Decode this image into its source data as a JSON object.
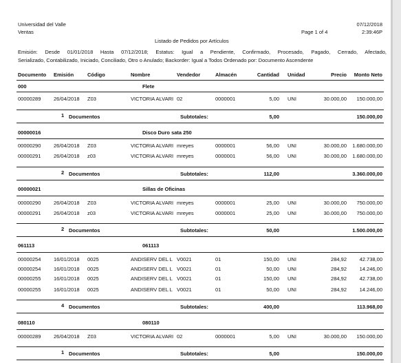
{
  "header": {
    "company": "Universidad del Valle",
    "module": "Ventas",
    "date": "07/12/2018",
    "page": "Page 1 of 4",
    "time": "2:39:46P",
    "title": "Listado de Pedidos por Artículos"
  },
  "params": {
    "line1": "Emisión: Desde 01/01/2018 Hasta 07/12/2018; Estatus: Igual a Pendiente, Confirmado, Procesado, Pagado, Cerrado, Afectado,",
    "line2": "Serializado, Contabilizado, Iniciado, Conciliado, Otro o Anulado; Backorder: Igual a Todos Ordenado por: Documento Ascendente"
  },
  "columns": {
    "documento": "Documento",
    "emision": "Emisión",
    "codigo": "Código",
    "nombre": "Nombre",
    "vendedor": "Vendedor",
    "almacen": "Almacén",
    "cantidad": "Cantidad",
    "unidad": "Unidad",
    "precio": "Precio",
    "monto": "Monto Neto"
  },
  "labels": {
    "documentos": "Documentos",
    "subtotales": "Subtotales:"
  },
  "groups": [
    {
      "code": "000",
      "name": "Flete",
      "rows": [
        {
          "doc": "00000289",
          "date": "26/04/2018",
          "cod": "Z03",
          "nombre": "VICTORIA ALVARI",
          "vend": "02",
          "alm": "0000001",
          "cant": "5,00",
          "uni": "UNI",
          "precio": "30.000,00",
          "monto": "150.000,00"
        }
      ],
      "count": "1",
      "sub_cant": "5,00",
      "sub_monto": "150.000,00"
    },
    {
      "code": "00000016",
      "name": "Disco Duro sata 250",
      "rows": [
        {
          "doc": "00000290",
          "date": "26/04/2018",
          "cod": "Z03",
          "nombre": "VICTORIA ALVARI",
          "vend": "mreyes",
          "alm": "0000001",
          "cant": "56,00",
          "uni": "UNI",
          "precio": "30.000,00",
          "monto": "1.680.000,00"
        },
        {
          "doc": "00000291",
          "date": "26/04/2018",
          "cod": "z03",
          "nombre": "VICTORIA ALVARI",
          "vend": "mreyes",
          "alm": "0000001",
          "cant": "56,00",
          "uni": "UNI",
          "precio": "30.000,00",
          "monto": "1.680.000,00"
        }
      ],
      "count": "2",
      "sub_cant": "112,00",
      "sub_monto": "3.360.000,00"
    },
    {
      "code": "00000021",
      "name": "Sillas de Oficinas",
      "rows": [
        {
          "doc": "00000290",
          "date": "26/04/2018",
          "cod": "Z03",
          "nombre": "VICTORIA ALVARI",
          "vend": "mreyes",
          "alm": "0000001",
          "cant": "25,00",
          "uni": "UNI",
          "precio": "30.000,00",
          "monto": "750.000,00"
        },
        {
          "doc": "00000291",
          "date": "26/04/2018",
          "cod": "z03",
          "nombre": "VICTORIA ALVARI",
          "vend": "mreyes",
          "alm": "0000001",
          "cant": "25,00",
          "uni": "UNI",
          "precio": "30.000,00",
          "monto": "750.000,00"
        }
      ],
      "count": "2",
      "sub_cant": "50,00",
      "sub_monto": "1.500.000,00"
    },
    {
      "code": "061113",
      "name": "061113",
      "rows": [
        {
          "doc": "00000254",
          "date": "16/01/2018",
          "cod": "0025",
          "nombre": "ANDISERV DEL L",
          "vend": "V0021",
          "alm": "01",
          "cant": "150,00",
          "uni": "UNI",
          "precio": "284,92",
          "monto": "42.738,00"
        },
        {
          "doc": "00000254",
          "date": "16/01/2018",
          "cod": "0025",
          "nombre": "ANDISERV DEL L",
          "vend": "V0021",
          "alm": "01",
          "cant": "50,00",
          "uni": "UNI",
          "precio": "284,92",
          "monto": "14.246,00"
        },
        {
          "doc": "00000255",
          "date": "16/01/2018",
          "cod": "0025",
          "nombre": "ANDISERV DEL L",
          "vend": "V0021",
          "alm": "01",
          "cant": "150,00",
          "uni": "UNI",
          "precio": "284,92",
          "monto": "42.738,00"
        },
        {
          "doc": "00000255",
          "date": "16/01/2018",
          "cod": "0025",
          "nombre": "ANDISERV DEL L",
          "vend": "V0021",
          "alm": "01",
          "cant": "50,00",
          "uni": "UNI",
          "precio": "284,92",
          "monto": "14.246,00"
        }
      ],
      "count": "4",
      "sub_cant": "400,00",
      "sub_monto": "113.968,00"
    },
    {
      "code": "080110",
      "name": "080110",
      "rows": [
        {
          "doc": "00000289",
          "date": "26/04/2018",
          "cod": "Z03",
          "nombre": "VICTORIA ALVARI",
          "vend": "02",
          "alm": "0000001",
          "cant": "5,00",
          "uni": "UNI",
          "precio": "30.000,00",
          "monto": "150.000,00"
        }
      ],
      "count": "1",
      "sub_cant": "5,00",
      "sub_monto": "150.000,00"
    }
  ]
}
